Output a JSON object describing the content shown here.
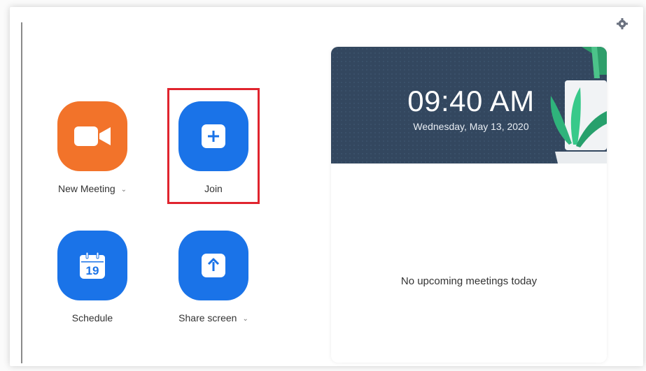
{
  "actions": {
    "new_meeting": {
      "label": "New Meeting",
      "chevron": "⌄",
      "icon": "video-camera-icon",
      "color": "#f2732a"
    },
    "join": {
      "label": "Join",
      "icon": "plus-icon",
      "color": "#1a73e8"
    },
    "schedule": {
      "label": "Schedule",
      "icon": "calendar-icon",
      "calendar_day": "19",
      "color": "#1a73e8"
    },
    "share_screen": {
      "label": "Share screen",
      "chevron": "⌄",
      "icon": "upload-arrow-icon",
      "color": "#1a73e8"
    }
  },
  "highlight_color": "#e0242e",
  "clock": {
    "time": "09:40 AM",
    "date": "Wednesday, May 13, 2020"
  },
  "meetings": {
    "empty_message": "No upcoming meetings today"
  },
  "header": {
    "settings_icon": "gear-icon"
  }
}
